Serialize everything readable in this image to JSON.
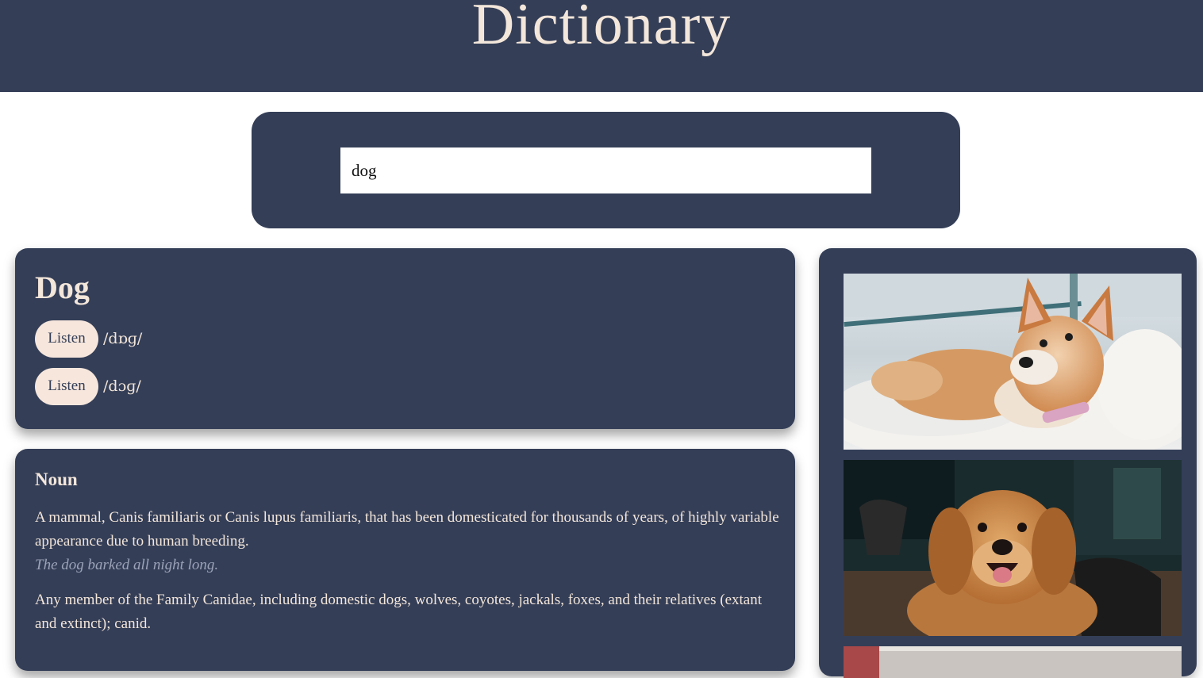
{
  "header": {
    "title": "Dictionary"
  },
  "search": {
    "value": "dog"
  },
  "word": {
    "title": "Dog",
    "phonetics": [
      {
        "button_label": "Listen",
        "text": "/dɒɡ/"
      },
      {
        "button_label": "Listen",
        "text": "/dɔɡ/"
      }
    ]
  },
  "meaning": {
    "part_of_speech": "Noun",
    "definitions": [
      {
        "definition": "A mammal, Canis familiaris or Canis lupus familiaris, that has been domesticated for thousands of years, of highly variable appearance due to human breeding.",
        "example": "The dog barked all night long."
      },
      {
        "definition": "Any member of the Family Canidae, including domestic dogs, wolves, coyotes, jackals, foxes, and their relatives (extant and extinct); canid.",
        "example": ""
      }
    ]
  },
  "images": [
    {
      "icon": "shiba-inu-puppy-photo"
    },
    {
      "icon": "golden-retriever-photo"
    },
    {
      "icon": "dog-photo"
    }
  ],
  "colors": {
    "navy": "#343e57",
    "cream": "#f3e6da",
    "button_bg": "#f6e6dc",
    "example_text": "#9ba3b8"
  }
}
